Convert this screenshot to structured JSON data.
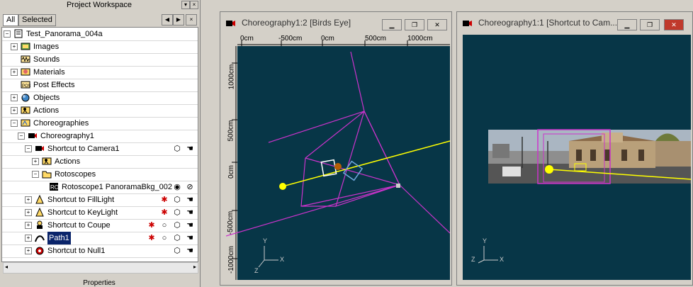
{
  "workspace": {
    "title": "Project Workspace",
    "tabs": [
      "All",
      "Selected"
    ],
    "tree": [
      {
        "label": "Test_Panorama_004a",
        "pm": "minus",
        "icon": "project-icon"
      },
      {
        "label": "Images",
        "pm": "plus",
        "icon": "images-icon"
      },
      {
        "label": "Sounds",
        "pm": "",
        "icon": "sounds-icon"
      },
      {
        "label": "Materials",
        "pm": "plus",
        "icon": "materials-icon"
      },
      {
        "label": "Post Effects",
        "pm": "",
        "icon": "post-effects-icon"
      },
      {
        "label": "Objects",
        "pm": "plus",
        "icon": "objects-icon"
      },
      {
        "label": "Actions",
        "pm": "plus",
        "icon": "actions-icon"
      },
      {
        "label": "Choreographies",
        "pm": "minus",
        "icon": "choreographies-icon"
      },
      {
        "label": "Choreography1",
        "pm": "minus",
        "icon": "choreography-icon"
      },
      {
        "label": "Shortcut to Camera1",
        "pm": "minus",
        "icon": "camera-icon"
      },
      {
        "label": "Actions",
        "pm": "plus",
        "icon": "actions-icon"
      },
      {
        "label": "Rotoscopes",
        "pm": "minus",
        "icon": "folder-icon"
      },
      {
        "label": "Rotoscope1 PanoramaBkg_002",
        "pm": "",
        "icon": "rotoscope-icon"
      },
      {
        "label": "Shortcut to FillLight",
        "pm": "plus",
        "icon": "light-icon"
      },
      {
        "label": "Shortcut to KeyLight",
        "pm": "plus",
        "icon": "light-icon"
      },
      {
        "label": "Shortcut to Coupe",
        "pm": "plus",
        "icon": "model-icon"
      },
      {
        "label": "Path1",
        "pm": "plus",
        "icon": "path-icon"
      },
      {
        "label": "Shortcut to Null1",
        "pm": "plus",
        "icon": "null-icon"
      }
    ],
    "properties_label": "Properties"
  },
  "viewport_left": {
    "title": "Choreography1:2 [Birds Eye]",
    "ruler_top": [
      "0cm",
      "-500cm",
      "0cm",
      "500cm",
      "1000cm"
    ],
    "ruler_left": [
      "1000cm",
      "500cm",
      "0cm",
      "-500cm",
      "-1000cm"
    ]
  },
  "viewport_right": {
    "title": "Choreography1:1 [Shortcut to Cam..."
  },
  "axis_labels": {
    "x": "X",
    "y": "Y",
    "z": "Z"
  },
  "colors": {
    "viewport_bg": "#073647",
    "selection": "#0a246a",
    "path_yellow": "#ffff00",
    "frustum_magenta": "#cc33cc"
  }
}
